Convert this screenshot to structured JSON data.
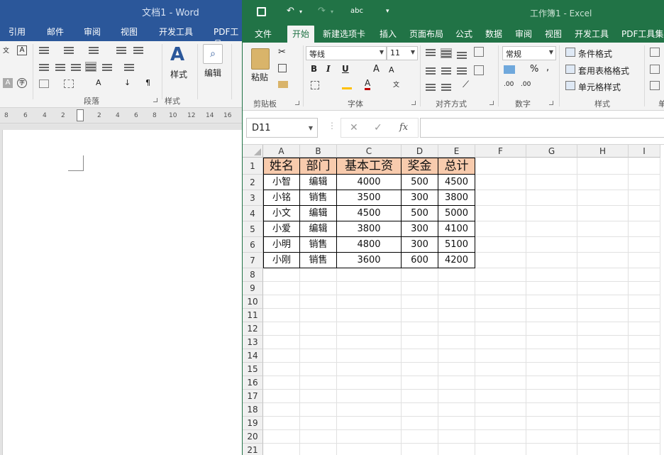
{
  "word": {
    "title": "文档1 - Word",
    "tabs": [
      "引用",
      "邮件",
      "审阅",
      "视图",
      "开发工具",
      "PDF工具"
    ],
    "ribbon": {
      "styles_label": "样式",
      "edit_label": "编辑",
      "paragraph_group": "段落",
      "styles_group": "样式"
    },
    "ruler_ticks": [
      "8",
      "6",
      "4",
      "2",
      "2",
      "4",
      "6",
      "8",
      "10",
      "12",
      "14",
      "16"
    ]
  },
  "excel": {
    "title": "工作簿1 - Excel",
    "tabs": [
      "文件",
      "开始",
      "新建选项卡",
      "插入",
      "页面布局",
      "公式",
      "数据",
      "审阅",
      "视图",
      "开发工具",
      "PDF工具集"
    ],
    "active_tab": "开始",
    "ribbon": {
      "paste_label": "粘贴",
      "font_name": "等线",
      "font_size": "11",
      "number_format": "常规",
      "conditional_format": "条件格式",
      "table_format": "套用表格格式",
      "cell_styles": "单元格样式",
      "groups": {
        "clipboard": "剪贴板",
        "font": "字体",
        "alignment": "对齐方式",
        "number": "数字",
        "styles": "样式",
        "cells": "单"
      }
    },
    "name_box": "D11",
    "formula_value": "",
    "columns": [
      "A",
      "B",
      "C",
      "D",
      "E",
      "F",
      "G",
      "H",
      "I"
    ],
    "rows": [
      "1",
      "2",
      "3",
      "4",
      "5",
      "6",
      "7",
      "8",
      "9",
      "10",
      "11",
      "12",
      "13",
      "14",
      "15",
      "16",
      "17",
      "18",
      "19",
      "20",
      "21"
    ],
    "table": {
      "headers": [
        "姓名",
        "部门",
        "基本工资",
        "奖金",
        "总计"
      ],
      "rows": [
        [
          "小智",
          "编辑",
          "4000",
          "500",
          "4500"
        ],
        [
          "小铭",
          "销售",
          "3500",
          "300",
          "3800"
        ],
        [
          "小文",
          "编辑",
          "4500",
          "500",
          "5000"
        ],
        [
          "小爱",
          "编辑",
          "3800",
          "300",
          "4100"
        ],
        [
          "小明",
          "销售",
          "4800",
          "300",
          "5100"
        ],
        [
          "小刚",
          "销售",
          "3600",
          "600",
          "4200"
        ]
      ]
    },
    "colors": {
      "excel_green": "#217346",
      "word_blue": "#2b579a",
      "header_fill": "#f8cbad"
    }
  }
}
